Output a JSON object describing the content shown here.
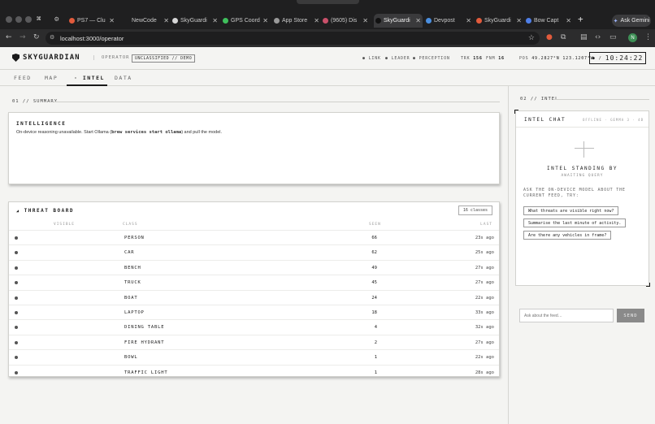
{
  "browser": {
    "tabs": [
      {
        "label": "PS7 — Clu",
        "fav": "#e25b3c",
        "active": false
      },
      {
        "label": "NewCode",
        "fav": "",
        "active": false
      },
      {
        "label": "SkyGuardi",
        "fav": "#d6d6d6",
        "active": false
      },
      {
        "label": "GPS Coord",
        "fav": "#3fbf5c",
        "active": false
      },
      {
        "label": "App Store",
        "fav": "#9a9a9a",
        "active": false
      },
      {
        "label": "(9605) Dis",
        "fav": "#c9506a",
        "active": false
      },
      {
        "label": "SkyGuardi",
        "fav": "#111111",
        "active": true
      },
      {
        "label": "Devpost",
        "fav": "#4b8fe0",
        "active": false
      },
      {
        "label": "SkyGuardi",
        "fav": "#e25b3c",
        "active": false
      },
      {
        "label": "Bow Capt",
        "fav": "#4f7fe8",
        "active": false
      }
    ],
    "new_tab": "+",
    "ask_label": "Ask Gemini",
    "url": "localhost:3000/operator",
    "avatar_initial": "N"
  },
  "header": {
    "logo": "SKYGUARDIAN",
    "role": "OPERATOR",
    "classification": "UNCLASSIFIED // DEMO",
    "status": [
      "LINK",
      "LEADER",
      "PERCEPTION"
    ],
    "trk_label": "TRK",
    "trk_value": "156",
    "fnm_label": "FNM",
    "fnm_value": "16",
    "pos_label": "POS",
    "pos_value": "49.2827°N 123.1207°W",
    "clock": "10:24:22"
  },
  "nav": {
    "tabs": [
      "FEED",
      "MAP",
      "· INTEL",
      "DATA"
    ],
    "active": 2
  },
  "summary": {
    "section_label": "01 // SUMMARY",
    "card_title": "INTELLIGENCE",
    "text_before": "On-device reasoning unavailable. Start Ollama (",
    "code": "brew services start ollama",
    "text_after": ") and pull the model."
  },
  "threat_board": {
    "title": "THREAT BOARD",
    "badge": "16 classes",
    "columns": [
      "VISIBLE",
      "CLASS",
      "SEEN",
      "LAST"
    ],
    "rows": [
      {
        "cls": "PERSON",
        "seen": "66",
        "last": "23s ago"
      },
      {
        "cls": "CAR",
        "seen": "62",
        "last": "25s ago"
      },
      {
        "cls": "BENCH",
        "seen": "49",
        "last": "27s ago"
      },
      {
        "cls": "TRUCK",
        "seen": "45",
        "last": "27s ago"
      },
      {
        "cls": "BOAT",
        "seen": "24",
        "last": "22s ago"
      },
      {
        "cls": "LAPTOP",
        "seen": "18",
        "last": "33s ago"
      },
      {
        "cls": "DINING TABLE",
        "seen": "4",
        "last": "32s ago"
      },
      {
        "cls": "FIRE HYDRANT",
        "seen": "2",
        "last": "27s ago"
      },
      {
        "cls": "BOWL",
        "seen": "1",
        "last": "22s ago"
      },
      {
        "cls": "TRAFFIC LIGHT",
        "seen": "1",
        "last": "28s ago"
      }
    ]
  },
  "intel_panel": {
    "section_label": "02 // INTEL",
    "chat_title": "INTEL CHAT",
    "model": "OFFLINE · GEMMA 3 · 4B",
    "standby": "INTEL STANDING BY",
    "awaiting": "AWAITING QUERY",
    "prompt": "ASK THE ON-DEVICE MODEL ABOUT THE CURRENT FEED, TRY:",
    "suggestions": [
      "What threats are visible right now?",
      "Summarise the last minute of activity.",
      "Are there any vehicles in frame?"
    ],
    "input_placeholder": "Ask about the feed…",
    "send_label": "SEND"
  }
}
